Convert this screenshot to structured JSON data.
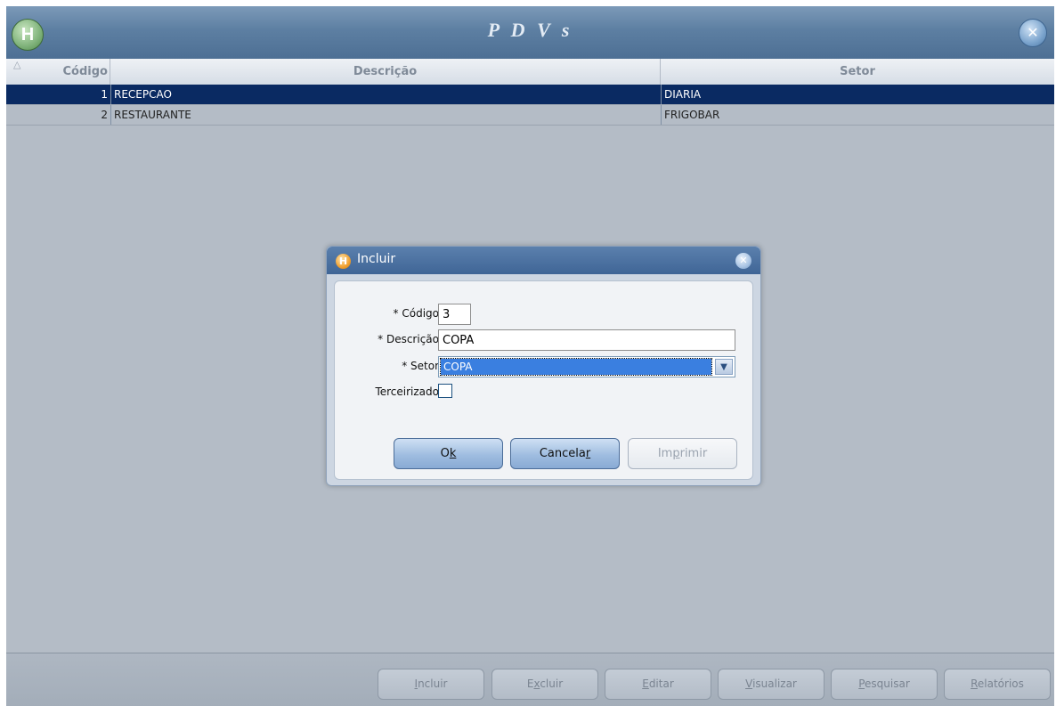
{
  "window": {
    "title": "P D V s",
    "logo_letter": "H",
    "close_glyph": "✕"
  },
  "grid": {
    "sort_glyph": "△",
    "columns": [
      "Código",
      "Descrição",
      "Setor"
    ],
    "rows": [
      {
        "codigo": "1",
        "descricao": "RECEPCAO",
        "setor": "DIARIA",
        "selected": true
      },
      {
        "codigo": "2",
        "descricao": "RESTAURANTE",
        "setor": "FRIGOBAR",
        "selected": false
      }
    ]
  },
  "toolbar": {
    "buttons": [
      {
        "pre": "",
        "key": "I",
        "post": "ncluir"
      },
      {
        "pre": "E",
        "key": "x",
        "post": "cluir"
      },
      {
        "pre": "",
        "key": "E",
        "post": "ditar"
      },
      {
        "pre": "",
        "key": "V",
        "post": "isualizar"
      },
      {
        "pre": "",
        "key": "P",
        "post": "esquisar"
      },
      {
        "pre": "",
        "key": "R",
        "post": "elatórios"
      }
    ]
  },
  "dialog": {
    "title": "Incluir",
    "logo_letter": "H",
    "close_glyph": "✕",
    "fields": {
      "codigo_label": "* Código",
      "codigo_value": "3",
      "descricao_label": "* Descrição",
      "descricao_value": "COPA",
      "setor_label": "* Setor",
      "setor_value": "COPA",
      "setor_arrow": "▼",
      "terceirizado_label": "Terceirizado",
      "terceirizado_checked": false
    },
    "buttons": {
      "ok": {
        "pre": "O",
        "key": "k",
        "post": ""
      },
      "cancelar": {
        "pre": "Cancela",
        "key": "r",
        "post": ""
      },
      "imprimir": {
        "pre": "Im",
        "key": "p",
        "post": "rimir"
      }
    }
  },
  "colors": {
    "selected_row": "#0a2a62",
    "titlebar": "#5d7fa2",
    "background": "#b4bcc6",
    "select_highlight": "#3a7fe0"
  }
}
